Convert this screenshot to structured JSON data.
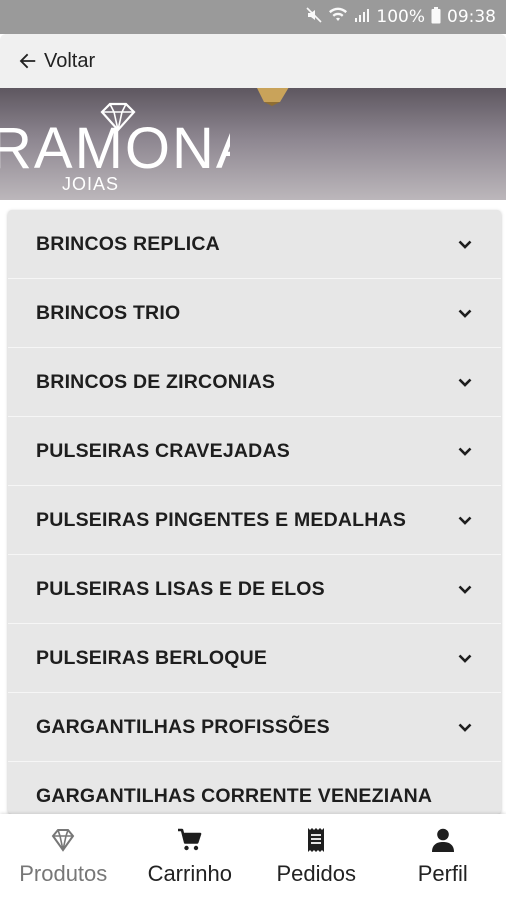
{
  "status_bar": {
    "icons": [
      "mute-icon",
      "wifi-icon",
      "signal-icon",
      "battery-icon"
    ],
    "battery": "100%",
    "time": "09:38"
  },
  "app_bar": {
    "back_label": "Voltar",
    "back_icon": "arrow-left-icon"
  },
  "banner": {
    "brand_name": "RAMONA",
    "brand_sub": "JOIAS",
    "logo_icon": "diamond-icon"
  },
  "categories": [
    {
      "label": "BRINCOS REPLICA"
    },
    {
      "label": "BRINCOS TRIO"
    },
    {
      "label": "BRINCOS DE ZIRCONIAS"
    },
    {
      "label": "PULSEIRAS CRAVEJADAS"
    },
    {
      "label": "PULSEIRAS PINGENTES E MEDALHAS"
    },
    {
      "label": "PULSEIRAS LISAS E DE ELOS"
    },
    {
      "label": "PULSEIRAS BERLOQUE"
    },
    {
      "label": "GARGANTILHAS PROFISSÕES"
    },
    {
      "label": "GARGANTILHAS CORRENTE VENEZIANA"
    }
  ],
  "bottom_nav": {
    "active": "Produtos",
    "tabs": [
      {
        "label": "Produtos",
        "icon": "diamond-icon"
      },
      {
        "label": "Carrinho",
        "icon": "cart-icon"
      },
      {
        "label": "Pedidos",
        "icon": "receipt-icon"
      },
      {
        "label": "Perfil",
        "icon": "user-icon"
      }
    ]
  },
  "colors": {
    "status_bar_bg": "#9a9a9a",
    "app_bar_bg": "#f0f0f0",
    "list_bg": "#e7e7e7",
    "text_dark": "#1e1e1e",
    "tab_active": "#777777"
  }
}
